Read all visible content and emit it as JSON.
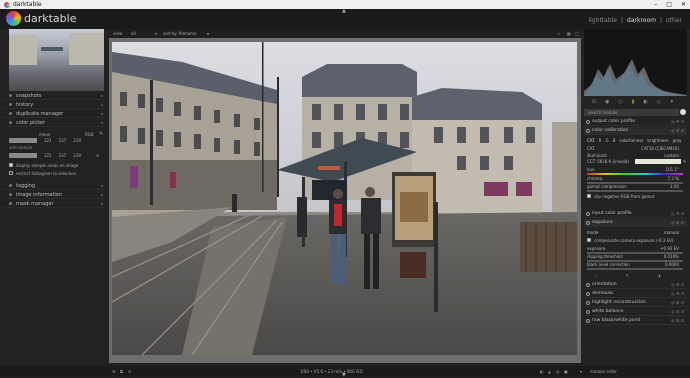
{
  "window": {
    "title": "darktable"
  },
  "header": {
    "app_name": "darktable",
    "views": [
      "lighttable",
      "|",
      "darkroom",
      "|",
      "other"
    ]
  },
  "left_modules": [
    {
      "label": "snapshots"
    },
    {
      "label": "history"
    },
    {
      "label": "duplicate manager"
    },
    {
      "label": "color picker"
    }
  ],
  "color_picker": {
    "mode": "mean",
    "model": "RGB",
    "rows": [
      {
        "label": "",
        "values": [
          "121",
          "137",
          "228"
        ]
      },
      {
        "label": "",
        "values": [
          "121",
          "137",
          "228"
        ]
      }
    ],
    "area_label": "add sample",
    "display_samples": "display sample areas on image",
    "restrict_histogram": "restrict histogram to selection"
  },
  "left_modules_2": [
    {
      "label": "tagging"
    },
    {
      "label": "image information"
    },
    {
      "label": "mask manager"
    }
  ],
  "top_toolbar": {
    "view_label": "view",
    "view_value": "all",
    "sort_label": "sort by",
    "sort_value": "filename"
  },
  "right_panel": {
    "search_placeholder": "search module",
    "modules_top": [
      {
        "label": "output color profile"
      },
      {
        "label": "color calibration"
      }
    ],
    "cc_tabs": [
      "CAT",
      "R",
      "G",
      "B",
      "colorfulness",
      "brightness",
      "gray"
    ],
    "cc_rows": [
      {
        "label": "CAT",
        "value": "CAT16 (CIECAM16)"
      },
      {
        "label": "illuminant",
        "value": "custom"
      },
      {
        "label": "hue",
        "value": "101.1°"
      },
      {
        "label": "chroma",
        "value": "7.3 %"
      },
      {
        "label": "gamut compression",
        "value": "1.00"
      },
      {
        "label": "clip negative RGB from gamut",
        "value": ""
      }
    ],
    "cct_label": "CCT: 5618 K (invalid)",
    "modules_mid": [
      {
        "label": "input color profile"
      },
      {
        "label": "exposure"
      }
    ],
    "exposure": {
      "mode_label": "mode",
      "mode_value": "manual",
      "compensate": "compensate camera exposure (-0.3 EV)",
      "rows": [
        {
          "label": "exposure",
          "value": "+0.92 EV"
        },
        {
          "label": "clipping threshold",
          "value": "0.010%"
        },
        {
          "label": "black level correction",
          "value": "0.0000"
        }
      ]
    },
    "modules_bottom": [
      {
        "label": "orientation"
      },
      {
        "label": "demosaic"
      },
      {
        "label": "highlight reconstruction"
      },
      {
        "label": "white balance"
      },
      {
        "label": "raw black/white point"
      }
    ]
  },
  "bottom_bar": {
    "exif": "1/80 • f/5.6 • 23 mm • 800 ISO",
    "module_order": "module order"
  },
  "colors": {
    "accent": "#7a9c3c",
    "panel": "#232323",
    "bg": "#1f1f1f"
  }
}
